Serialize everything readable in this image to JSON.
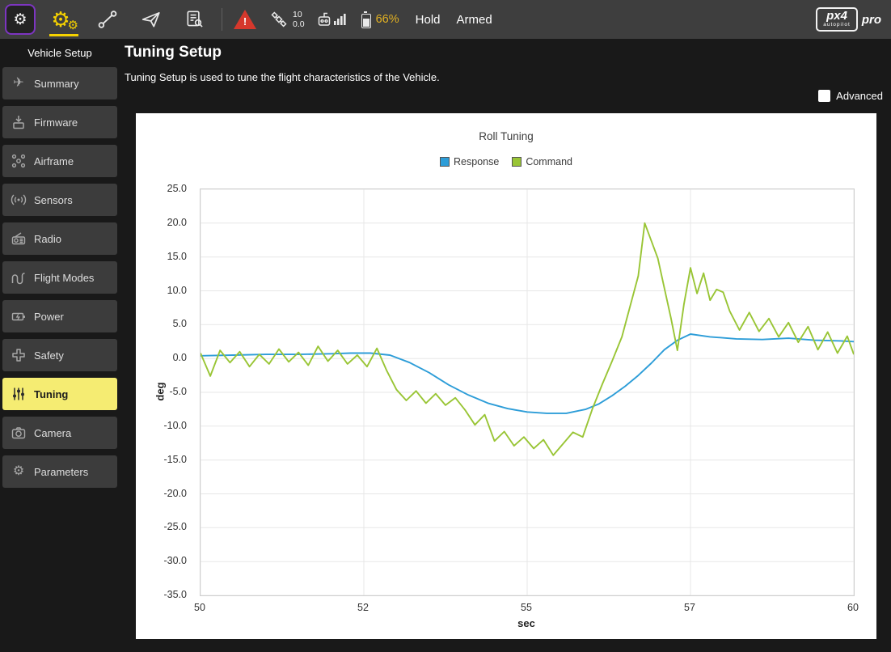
{
  "icons": {
    "gear": "⚙",
    "plane": "✈",
    "warning_mark": "!"
  },
  "colors": {
    "accent_yellow": "#f5ec72",
    "active_tab_yellow": "#f6d200",
    "battery_text": "#e2b122",
    "response_blue": "#2d9dd8",
    "command_green": "#99c535"
  },
  "toolbar": {
    "status": {
      "gps_count": "10",
      "gps_hdop": "0.0",
      "battery_pct": "66%",
      "flight_mode": "Hold",
      "arm_state": "Armed"
    },
    "logo": {
      "px4": "px4",
      "autopilot": "autopilot",
      "pro": "pro"
    }
  },
  "sidebar": {
    "header": "Vehicle Setup",
    "items": [
      {
        "label": "Summary",
        "icon": "summary-plane-icon"
      },
      {
        "label": "Firmware",
        "icon": "firmware-icon"
      },
      {
        "label": "Airframe",
        "icon": "airframe-icon"
      },
      {
        "label": "Sensors",
        "icon": "sensors-icon"
      },
      {
        "label": "Radio",
        "icon": "radio-icon"
      },
      {
        "label": "Flight Modes",
        "icon": "flight-modes-icon"
      },
      {
        "label": "Power",
        "icon": "power-icon"
      },
      {
        "label": "Safety",
        "icon": "safety-icon"
      },
      {
        "label": "Tuning",
        "icon": "tuning-icon",
        "selected": true
      },
      {
        "label": "Camera",
        "icon": "camera-icon"
      },
      {
        "label": "Parameters",
        "icon": "parameters-icon"
      }
    ]
  },
  "main": {
    "title": "Tuning Setup",
    "subtitle": "Tuning Setup is used to tune the flight characteristics of the Vehicle.",
    "advanced_label": "Advanced"
  },
  "chart_data": {
    "type": "line",
    "title": "Roll Tuning",
    "xlabel": "sec",
    "ylabel": "deg",
    "xlim": [
      50,
      60
    ],
    "ylim": [
      -35,
      25
    ],
    "grid": true,
    "legend_position": "top",
    "x_tick_labels": [
      "50",
      "52",
      "55",
      "57",
      "60"
    ],
    "y_tick_labels": [
      "25.0",
      "20.0",
      "15.0",
      "10.0",
      "5.0",
      "0.0",
      "-5.0",
      "-10.0",
      "-15.0",
      "-20.0",
      "-25.0",
      "-30.0",
      "-35.0"
    ],
    "legend": [
      {
        "name": "Response",
        "color": "#2d9dd8"
      },
      {
        "name": "Command",
        "color": "#99c535"
      }
    ],
    "series": [
      {
        "name": "Response",
        "color": "#2d9dd8",
        "x": [
          50.0,
          50.5,
          51.0,
          51.5,
          52.0,
          52.3,
          52.6,
          52.9,
          53.2,
          53.5,
          53.8,
          54.1,
          54.4,
          54.7,
          55.0,
          55.3,
          55.6,
          55.9,
          56.1,
          56.3,
          56.5,
          56.7,
          56.9,
          57.1,
          57.3,
          57.5,
          57.8,
          58.2,
          58.6,
          59.0,
          59.4,
          59.8,
          60.0
        ],
        "y": [
          0.4,
          0.5,
          0.6,
          0.6,
          0.7,
          0.8,
          0.8,
          0.5,
          -0.6,
          -2.1,
          -3.9,
          -5.4,
          -6.6,
          -7.4,
          -7.9,
          -8.1,
          -8.1,
          -7.5,
          -6.7,
          -5.5,
          -4.1,
          -2.5,
          -0.7,
          1.3,
          2.7,
          3.6,
          3.2,
          2.9,
          2.8,
          3.0,
          2.7,
          2.6,
          2.5
        ]
      },
      {
        "name": "Command",
        "color": "#99c535",
        "x": [
          50.0,
          50.15,
          50.3,
          50.45,
          50.6,
          50.75,
          50.9,
          51.05,
          51.2,
          51.35,
          51.5,
          51.65,
          51.8,
          51.95,
          52.1,
          52.25,
          52.4,
          52.55,
          52.7,
          52.85,
          53.0,
          53.15,
          53.3,
          53.45,
          53.6,
          53.75,
          53.9,
          54.05,
          54.2,
          54.35,
          54.5,
          54.65,
          54.8,
          54.95,
          55.1,
          55.25,
          55.4,
          55.55,
          55.7,
          55.85,
          56.0,
          56.15,
          56.3,
          56.45,
          56.6,
          56.7,
          56.8,
          56.9,
          57.0,
          57.1,
          57.2,
          57.3,
          57.4,
          57.5,
          57.6,
          57.7,
          57.8,
          57.9,
          58.0,
          58.1,
          58.25,
          58.4,
          58.55,
          58.7,
          58.85,
          59.0,
          59.15,
          59.3,
          59.45,
          59.6,
          59.75,
          59.9,
          60.0
        ],
        "y": [
          0.8,
          -2.6,
          1.2,
          -0.6,
          1.0,
          -1.2,
          0.6,
          -0.8,
          1.4,
          -0.5,
          0.9,
          -1.0,
          1.8,
          -0.4,
          1.2,
          -0.8,
          0.5,
          -1.2,
          1.5,
          -1.8,
          -4.6,
          -6.2,
          -4.8,
          -6.6,
          -5.2,
          -6.9,
          -5.8,
          -7.6,
          -9.8,
          -8.3,
          -12.2,
          -10.8,
          -12.9,
          -11.6,
          -13.3,
          -12.0,
          -14.3,
          -12.6,
          -10.9,
          -11.6,
          -7.4,
          -3.8,
          -0.4,
          3.2,
          8.6,
          12.2,
          20.0,
          17.4,
          14.8,
          10.4,
          6.0,
          1.2,
          8.0,
          13.4,
          9.6,
          12.6,
          8.6,
          10.2,
          9.8,
          7.0,
          4.2,
          6.8,
          4.0,
          5.9,
          3.2,
          5.3,
          2.4,
          4.7,
          1.3,
          3.9,
          0.8,
          3.3,
          0.6
        ]
      }
    ]
  }
}
